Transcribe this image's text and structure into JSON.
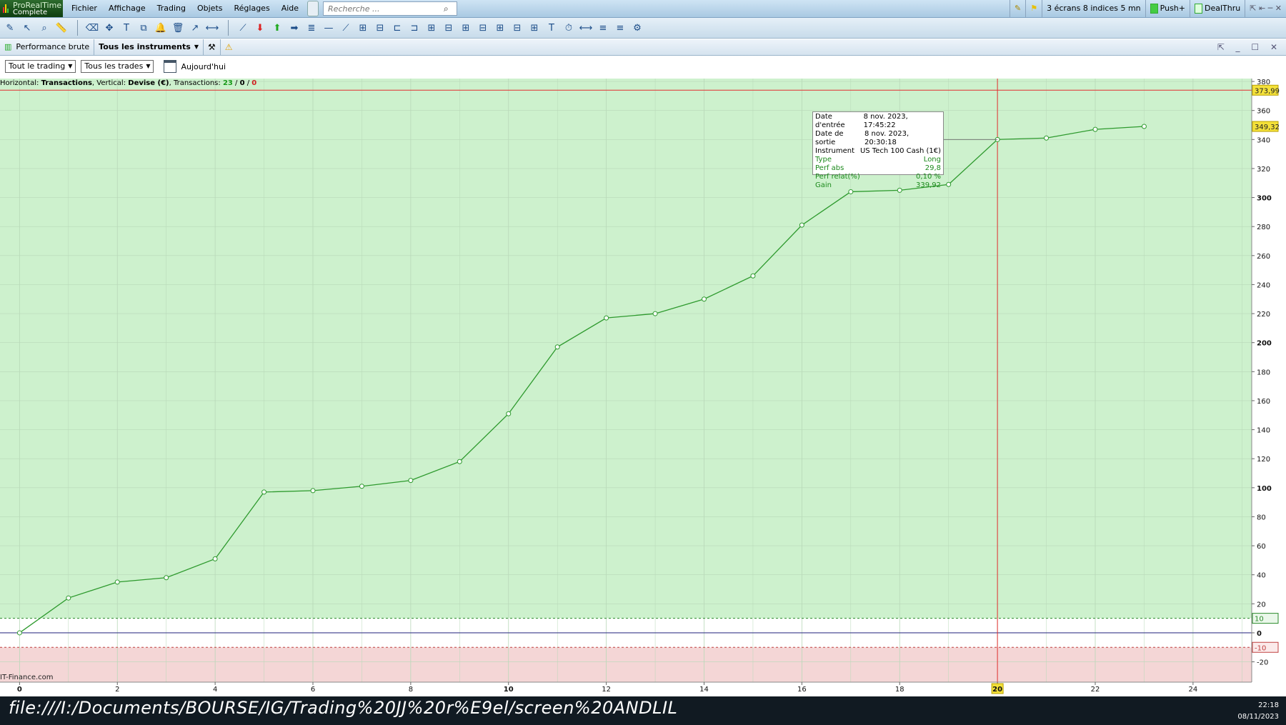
{
  "app": {
    "logo_line1": "ProRealTime",
    "logo_line2": "Complete"
  },
  "menu": [
    "Fichier",
    "Affichage",
    "Trading",
    "Objets",
    "Réglages",
    "Aide"
  ],
  "search": {
    "placeholder": "Recherche ..."
  },
  "top_right": {
    "layout": "3 écrans 8 indices 5 mn",
    "push": "Push+",
    "dealthru": "DealThru"
  },
  "toolbar_icons": [
    "pencil-icon",
    "cursor-icon",
    "zoom-icon",
    "ruler-icon",
    "eraser-icon",
    "crosshair-icon",
    "text-icon",
    "copy-icon",
    "bell-icon",
    "trash-icon",
    "arrow-icon",
    "segment-icon",
    "brush-icon",
    "sell-arrow-icon",
    "buy-arrow-icon",
    "right-arrow-icon",
    "fibo-icon",
    "hline-icon",
    "trendline-icon",
    "channel-icon",
    "channel2-icon",
    "vline-icon",
    "hline2-icon",
    "grid-icon",
    "grid2-icon",
    "grid3-icon",
    "grid4-icon",
    "grid5-icon",
    "grid6-icon",
    "grid7-icon",
    "text2-icon",
    "timezone-icon",
    "measure-icon",
    "list-icon",
    "list2-icon",
    "settings-icon"
  ],
  "window": {
    "mode": "Performance brute",
    "instruments": "Tous les instruments",
    "controls": "⇱ _ ☐ ✕"
  },
  "filters": {
    "trading": "Tout le trading",
    "trades": "Tous les trades",
    "period": "Aujourd'hui"
  },
  "info_line": {
    "prefix": "Horizontal: ",
    "h": "Transactions",
    "mid": ", Vertical: ",
    "v": "Devise (€)",
    "tx_label": ", Transactions: ",
    "total": "23",
    "sep1": " / ",
    "neutral": "0",
    "sep2": " / ",
    "losing": "0"
  },
  "tooltip": {
    "rows": [
      {
        "label": "Date d'entrée",
        "value": "8 nov. 2023, 17:45:22"
      },
      {
        "label": "Date de sortie",
        "value": "8 nov. 2023, 20:30:18"
      },
      {
        "label": "Instrument",
        "value": "US Tech 100 Cash (1€)"
      },
      {
        "label": "Type",
        "value": "Long"
      },
      {
        "label": "Perf abs",
        "value": "29,8"
      },
      {
        "label": "Perf relat(%)",
        "value": "0,10 %"
      },
      {
        "label": "Gain",
        "value": "339,92"
      }
    ]
  },
  "chart_data": {
    "type": "line",
    "x": [
      0,
      1,
      2,
      3,
      4,
      5,
      6,
      7,
      8,
      9,
      10,
      11,
      12,
      13,
      14,
      15,
      16,
      17,
      18,
      19,
      20,
      21,
      22,
      23
    ],
    "values": [
      0,
      24,
      35,
      38,
      51,
      97,
      98,
      101,
      105,
      118,
      151,
      197,
      217,
      220,
      230,
      246,
      281,
      304,
      305,
      309,
      340,
      341,
      347,
      349
    ],
    "xlim": [
      -0.4,
      25.2
    ],
    "ylim": [
      -34,
      382
    ],
    "x_ticks": [
      "0",
      "2",
      "4",
      "6",
      "8",
      "10",
      "12",
      "14",
      "16",
      "18",
      "20",
      "22",
      "24"
    ],
    "y_ticks": [
      "380",
      "360",
      "340",
      "320",
      "300",
      "280",
      "260",
      "240",
      "220",
      "200",
      "180",
      "160",
      "140",
      "120",
      "100",
      "80",
      "60",
      "40",
      "20",
      "0",
      "-20"
    ],
    "bold_y_ticks": [
      "300",
      "200",
      "100",
      "0"
    ],
    "bold_x_ticks": [
      "0",
      "10",
      "20"
    ],
    "upper_band": 10,
    "lower_band": -10,
    "max_line": 373.99,
    "cursor_x": 20,
    "labels": {
      "max": "373,99",
      "last": "349,32",
      "upper": "10",
      "lower": "-10",
      "cursor": "20"
    },
    "colors": {
      "positive_zone": "#cdf1cd",
      "negative_zone": "#f4d6d6",
      "line": "#2e9a2e",
      "max_line": "#e23030",
      "cursor": "#e23030"
    }
  },
  "copyright": "IT-Finance.com",
  "taskbar": {
    "path": "file:///I:/Documents/BOURSE/IG/Trading%20JJ%20r%E9el/screen%20ANDLIL",
    "time": "22:18",
    "date": "08/11/2023"
  }
}
